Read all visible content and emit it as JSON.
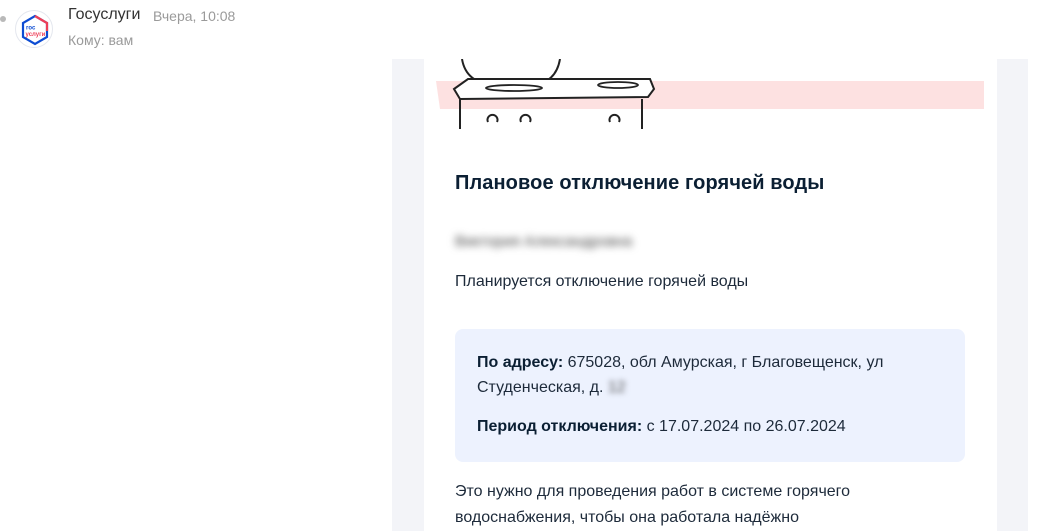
{
  "message": {
    "sender": "Госуслуги",
    "date": "Вчера, 10:08",
    "recipient": "Кому: вам",
    "avatar_logo_text": [
      "гос",
      "услуги"
    ]
  },
  "email": {
    "title": "Плановое отключение горячей воды",
    "greeting_name": "Виктория Александровна",
    "intro": "Планируется отключение горячей воды",
    "address_label": "По адресу:",
    "address_value_line1": "675028, обл Амурская, г Благовещенск, ул",
    "address_value_line2": "Студенческая, д.",
    "house_number": "12",
    "period_label": "Период отключения:",
    "period_value": "с 17.07.2024 по 26.07.2024",
    "footer_line1": "Это нужно для проведения работ в системе горячего",
    "footer_line2": "водоснабжения, чтобы она работала надёжно"
  },
  "colors": {
    "title": "#0b1f33",
    "info_box_bg": "#edf2fe",
    "email_frame_bg": "#f3f4f8",
    "logo_blue": "#0d4cd3",
    "logo_red": "#ee3f58",
    "illustration_band": "#fde1e1"
  },
  "icons": [
    "gosuslugi-logo",
    "sink-illustration"
  ]
}
